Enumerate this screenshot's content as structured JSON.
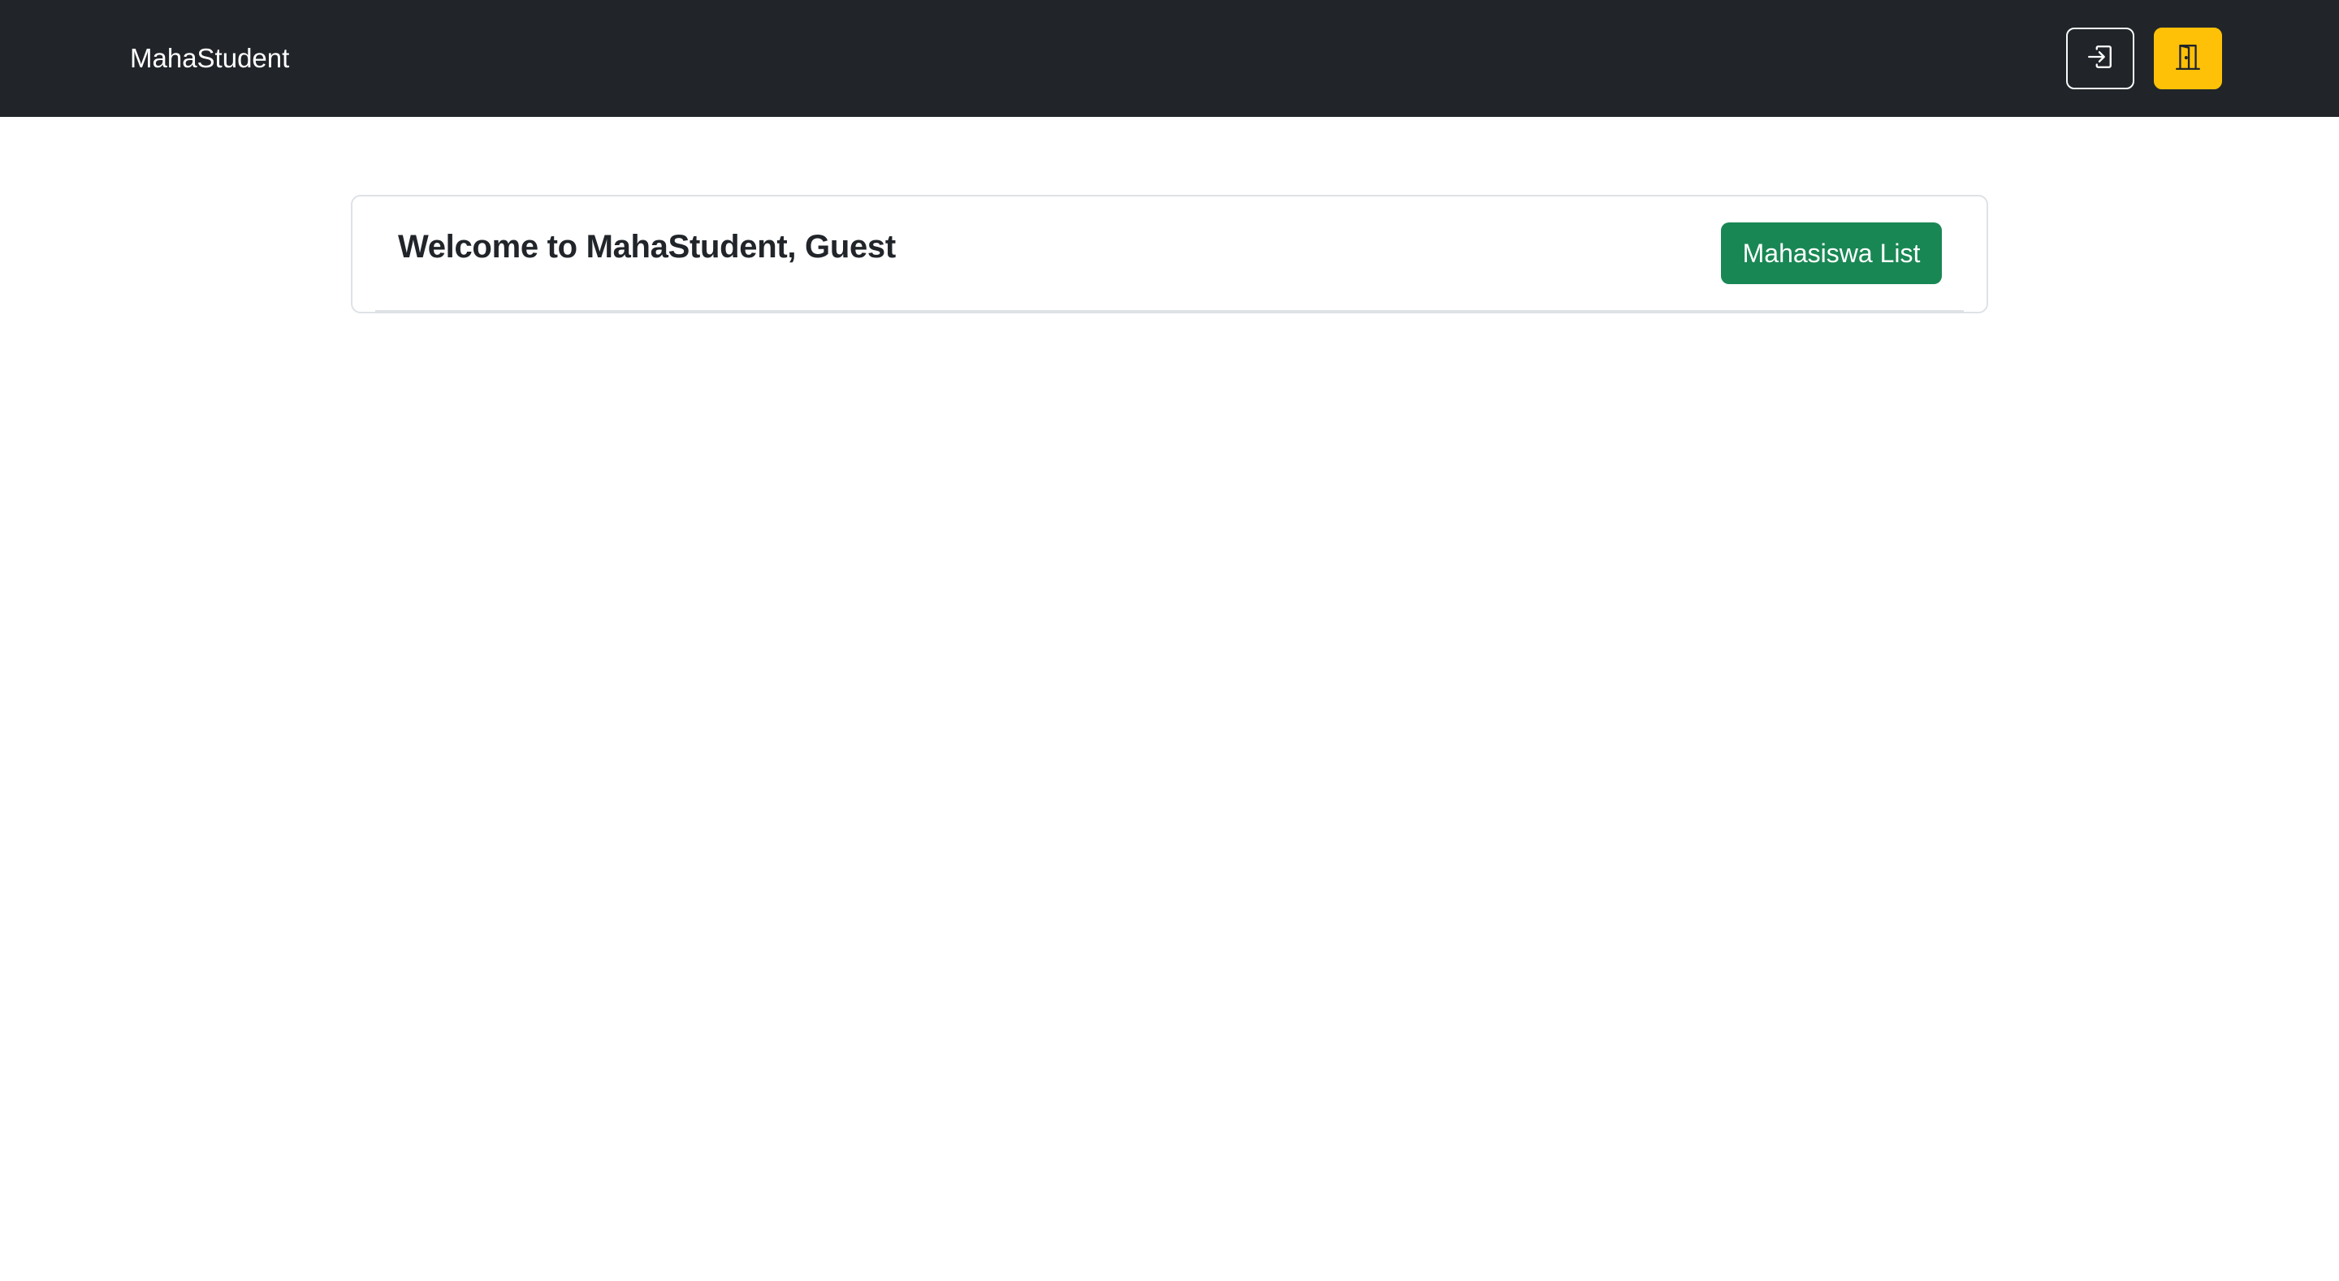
{
  "navbar": {
    "brand": "MahaStudent",
    "login_icon": "login-arrow-icon",
    "exit_icon": "door-icon",
    "colors": {
      "background": "#212529",
      "exit_button": "#ffc107"
    }
  },
  "main": {
    "welcome_text": "Welcome to MahaStudent, Guest",
    "list_button_label": "Mahasiswa List",
    "colors": {
      "list_button": "#198754"
    }
  }
}
